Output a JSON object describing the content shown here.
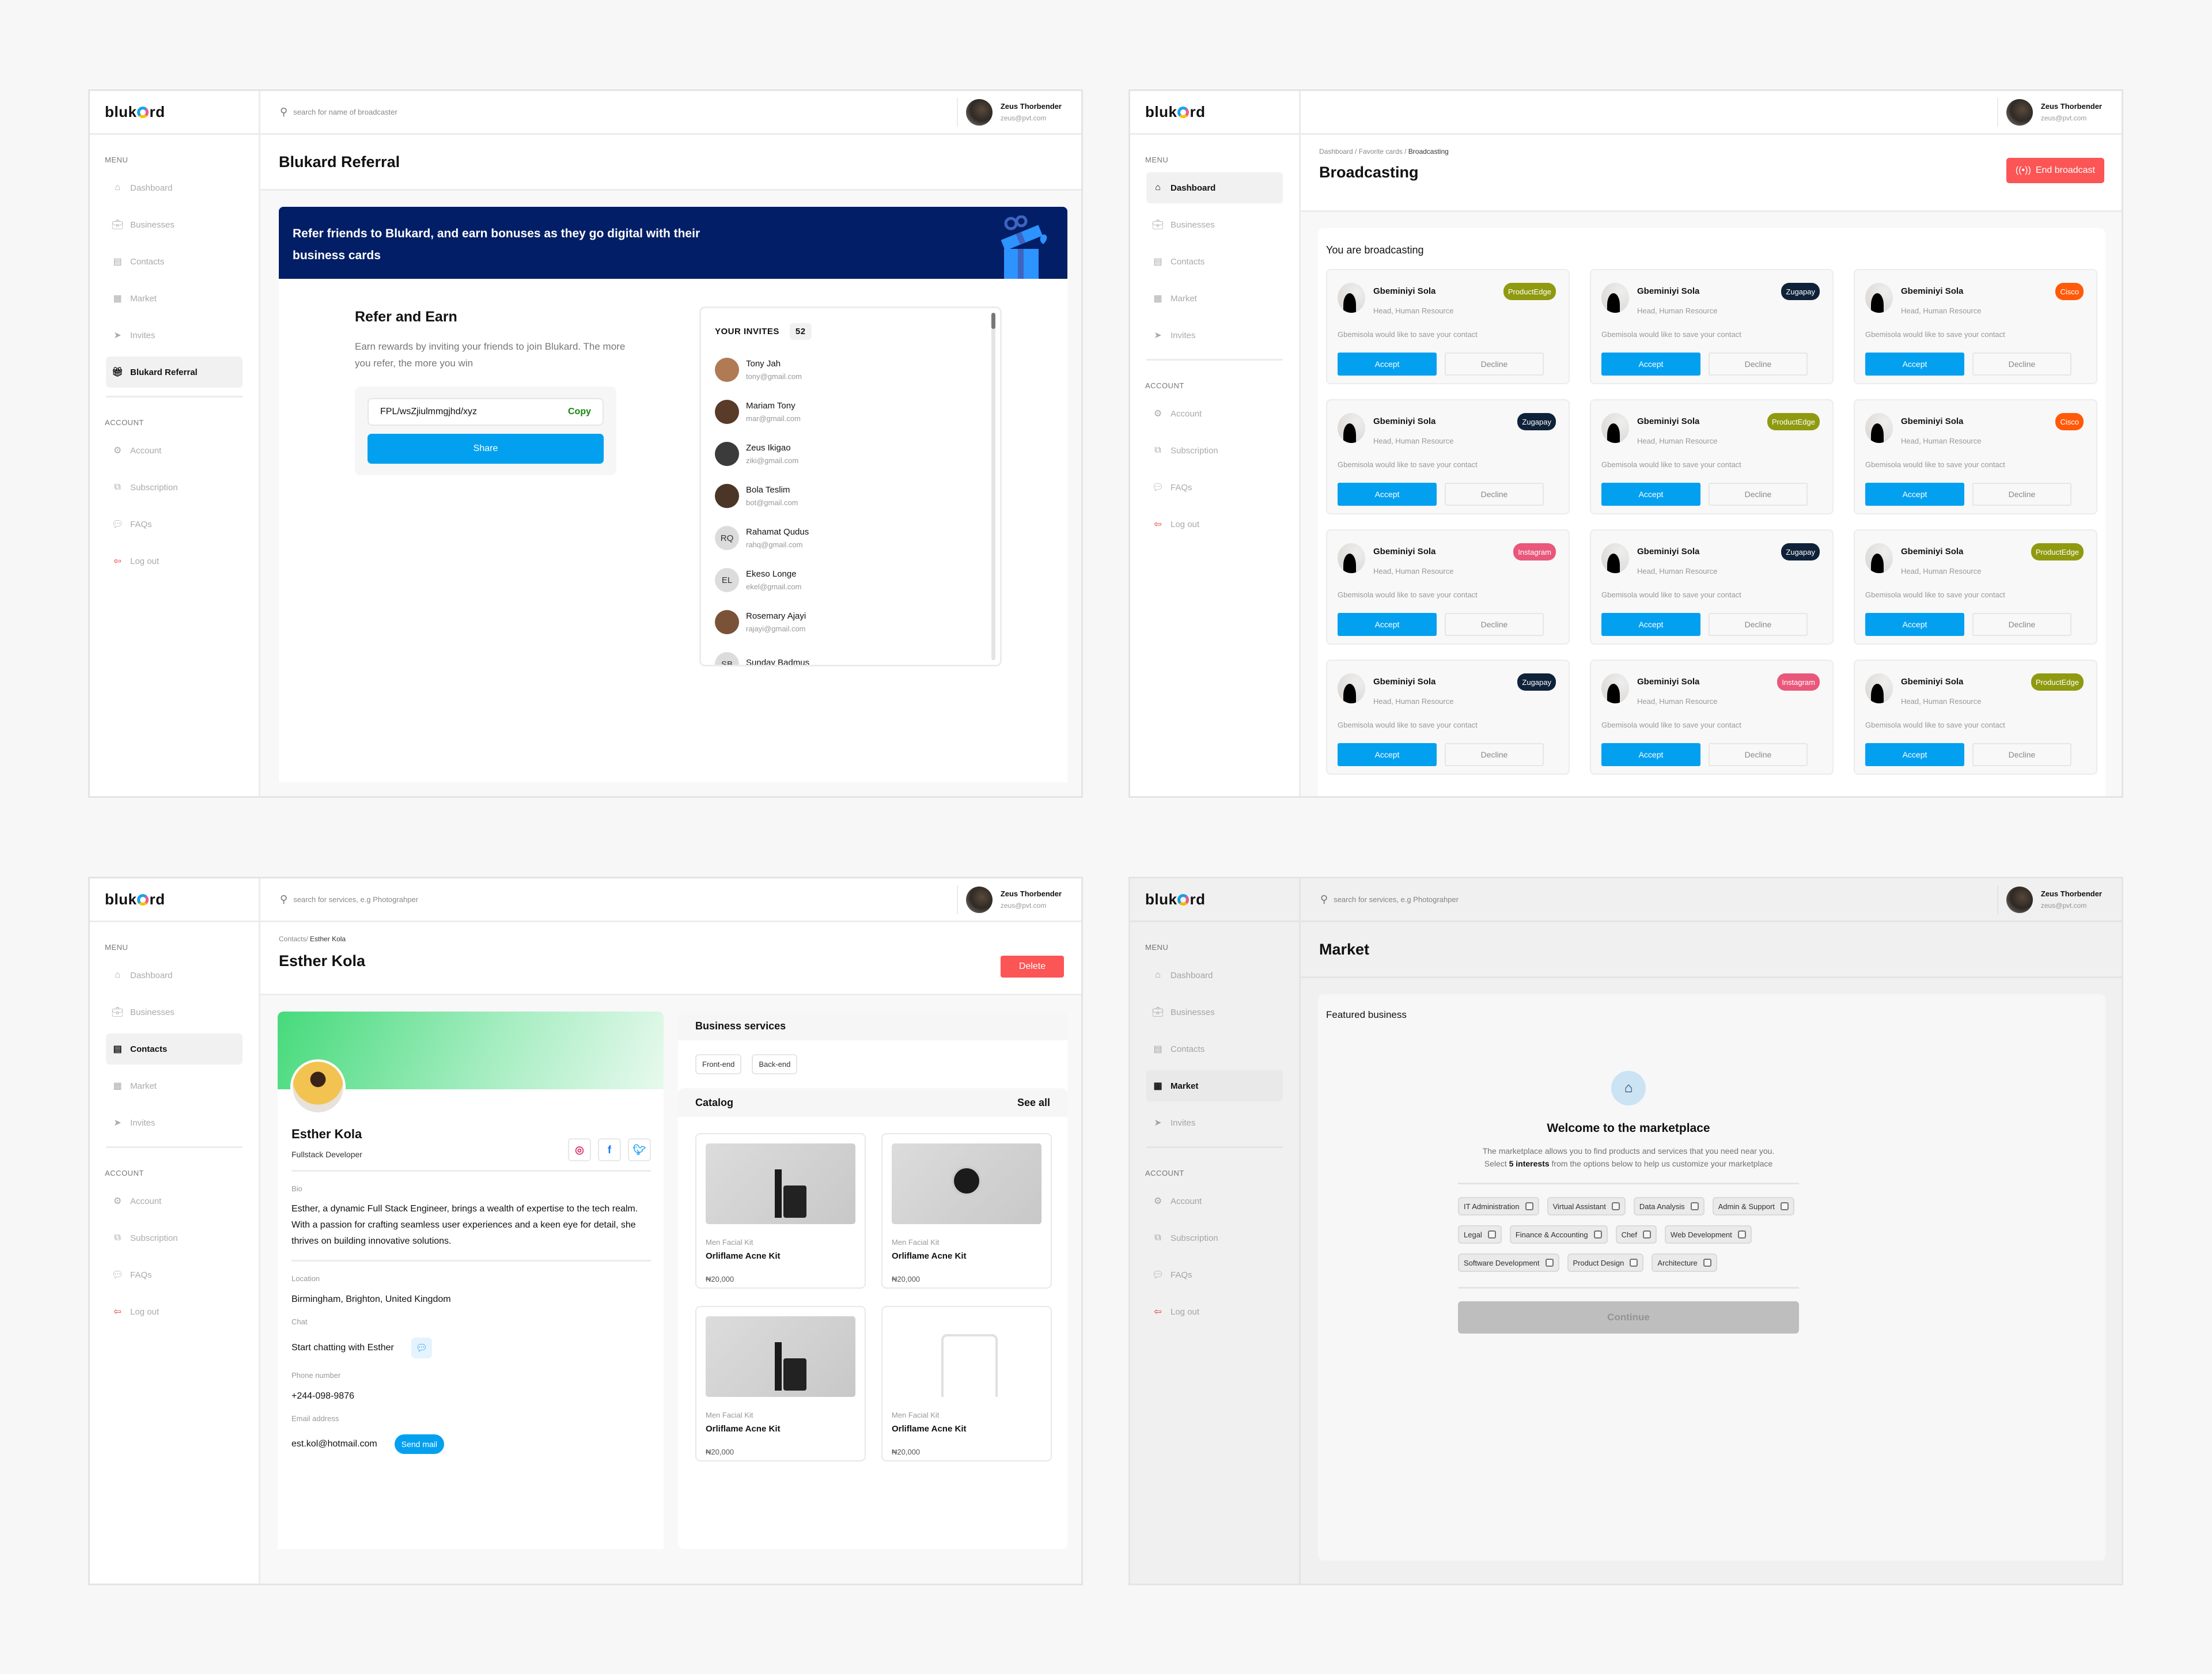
{
  "brand": {
    "logo_prefix": "bluk",
    "logo_suffix": "rd"
  },
  "user": {
    "name": "Zeus Thorbender",
    "email": "zeus@pvt.com"
  },
  "sidebar": {
    "menu_label": "MENU",
    "account_label": "ACCOUNT",
    "menu_items": [
      {
        "label": "Dashboard",
        "icon": "home-icon"
      },
      {
        "label": "Businesses",
        "icon": "briefcase-icon"
      },
      {
        "label": "Contacts",
        "icon": "contacts-card-icon"
      },
      {
        "label": "Market",
        "icon": "store-icon"
      },
      {
        "label": "Invites",
        "icon": "send-icon"
      }
    ],
    "referral_item": {
      "label": "Blukard Referral",
      "icon": "gift-icon"
    },
    "account_items": [
      {
        "label": "Account",
        "icon": "gear-icon"
      },
      {
        "label": "Subscription",
        "icon": "ticket-icon"
      },
      {
        "label": "FAQs",
        "icon": "chat-bubbles-icon"
      },
      {
        "label": "Log out",
        "icon": "logout-icon"
      }
    ]
  },
  "referral": {
    "search_placeholder": "search for name of broadcaster",
    "title": "Blukard Referral",
    "banner": "Refer friends to Blukard, and earn bonuses as they go digital with their business cards",
    "heading": "Refer and Earn",
    "description": "Earn rewards by inviting your friends to join Blukard. The more you refer, the more you win",
    "link": "FPL/wsZjiulmmgjhd/xyz",
    "copy_label": "Copy",
    "share_label": "Share",
    "invites_label": "YOUR INVITES",
    "invites_count": "52",
    "invites": [
      {
        "name": "Tony Jah",
        "email": "tony@gmail.com",
        "initials": "",
        "color": "#b07a55"
      },
      {
        "name": "Mariam Tony",
        "email": "mar@gmail.com",
        "initials": "",
        "color": "#5a3a28"
      },
      {
        "name": "Zeus Ikigao",
        "email": "ziki@gmail.com",
        "initials": "",
        "color": "#3b3b3b"
      },
      {
        "name": "Bola Teslim",
        "email": "bot@gmail.com",
        "initials": "",
        "color": "#4a3526"
      },
      {
        "name": "Rahamat Qudus",
        "email": "rahq@gmail.com",
        "initials": "RQ",
        "color": "#dcdcdc"
      },
      {
        "name": "Ekeso Longe",
        "email": "ekel@gmail.com",
        "initials": "EL",
        "color": "#dcdcdc"
      },
      {
        "name": "Rosemary Ajayi",
        "email": "rajayi@gmail.com",
        "initials": "",
        "color": "#7a5238"
      },
      {
        "name": "Sunday Badmus",
        "email": "",
        "initials": "SB",
        "color": "#dcdcdc"
      }
    ]
  },
  "broadcasting": {
    "breadcrumb": [
      "Dashboard",
      "Favorite cards",
      "Broadcasting"
    ],
    "title": "Broadcasting",
    "end_label": "End broadcast",
    "section_label": "You are broadcasting",
    "accept_label": "Accept",
    "decline_label": "Decline",
    "cards": [
      {
        "name": "Gbeminiyi Sola",
        "role": "Head, Human Resource",
        "message": "Gbemisola would like to save your contact",
        "badge": "ProductEdge",
        "badge_color": "#8f9a10"
      },
      {
        "name": "Gbeminiyi Sola",
        "role": "Head, Human Resource",
        "message": "Gbemisola would like to save your contact",
        "badge": "Zugapay",
        "badge_color": "#0f2239"
      },
      {
        "name": "Gbeminiyi Sola",
        "role": "Head, Human Resource",
        "message": "Gbemisola would like to save your contact",
        "badge": "Cisco",
        "badge_color": "#ff5a0a"
      },
      {
        "name": "Gbeminiyi Sola",
        "role": "Head, Human Resource",
        "message": "Gbemisola would like to save your contact",
        "badge": "Zugapay",
        "badge_color": "#0f2239"
      },
      {
        "name": "Gbeminiyi Sola",
        "role": "Head, Human Resource",
        "message": "Gbemisola would like to save your contact",
        "badge": "ProductEdge",
        "badge_color": "#8f9a10"
      },
      {
        "name": "Gbeminiyi Sola",
        "role": "Head, Human Resource",
        "message": "Gbemisola would like to save your contact",
        "badge": "Cisco",
        "badge_color": "#ff5a0a"
      },
      {
        "name": "Gbeminiyi Sola",
        "role": "Head, Human Resource",
        "message": "Gbemisola would like to save your contact",
        "badge": "Instagram",
        "badge_color": "#e9577a"
      },
      {
        "name": "Gbeminiyi Sola",
        "role": "Head, Human Resource",
        "message": "Gbemisola would like to save your contact",
        "badge": "Zugapay",
        "badge_color": "#0f2239"
      },
      {
        "name": "Gbeminiyi Sola",
        "role": "Head, Human Resource",
        "message": "Gbemisola would like to save your contact",
        "badge": "ProductEdge",
        "badge_color": "#8f9a10"
      },
      {
        "name": "Gbeminiyi Sola",
        "role": "Head, Human Resource",
        "message": "Gbemisola would like to save your contact",
        "badge": "Zugapay",
        "badge_color": "#0f2239"
      },
      {
        "name": "Gbeminiyi Sola",
        "role": "Head, Human Resource",
        "message": "Gbemisola would like to save your contact",
        "badge": "Instagram",
        "badge_color": "#e9577a"
      },
      {
        "name": "Gbeminiyi Sola",
        "role": "Head, Human Resource",
        "message": "Gbemisola would like to save your contact",
        "badge": "ProductEdge",
        "badge_color": "#8f9a10"
      }
    ]
  },
  "contact": {
    "search_placeholder": "search for services, e.g Photograhper",
    "breadcrumb_parent": "Contacts/",
    "breadcrumb_current": "Esther Kola",
    "title": "Esther Kola",
    "delete_label": "Delete",
    "name": "Esther Kola",
    "role": "Fullstack Developer",
    "bio_label": "Bio",
    "bio": "Esther, a dynamic Full Stack Engineer, brings a wealth of expertise to the tech realm. With a passion for crafting seamless user experiences and a keen eye for detail, she thrives on building innovative solutions.",
    "location_label": "Location",
    "location": "Birmingham, Brighton, United Kingdom",
    "chat_label": "Chat",
    "chat_text": "Start chatting with Esther",
    "phone_label": "Phone number",
    "phone": "+244-098-9876",
    "email_label": "Email address",
    "email": "est.kol@hotmail.com",
    "send_mail_label": "Send mail",
    "services_label": "Business services",
    "services": [
      "Front-end",
      "Back-end"
    ],
    "catalog_label": "Catalog",
    "see_all_label": "See all",
    "products": [
      {
        "category": "Men Facial Kit",
        "name": "Orliflame Acne Kit",
        "price": "₦20,000",
        "image": "kit"
      },
      {
        "category": "Men Facial Kit",
        "name": "Orliflame Acne Kit",
        "price": "₦20,000",
        "image": "watch"
      },
      {
        "category": "Men Facial Kit",
        "name": "Orliflame Acne Kit",
        "price": "₦20,000",
        "image": "kit"
      },
      {
        "category": "Men Facial Kit",
        "name": "Orliflame Acne Kit",
        "price": "₦20,000",
        "image": "empty"
      }
    ]
  },
  "market": {
    "search_placeholder": "search for services, e.g Photograhper",
    "title": "Market",
    "featured_label": "Featured business",
    "welcome_title": "Welcome to the marketplace",
    "welcome_text_1": "The marketplace allows you to find products and services that you need near you. Select ",
    "welcome_text_bold": "5 interests",
    "welcome_text_2": " from the options below to help us customize your marketplace",
    "interests": [
      "IT Administration",
      "Virtual Assistant",
      "Data Analysis",
      "Admin & Support",
      "Legal",
      "Finance & Accounting",
      "Chef",
      "Web Development",
      "Software Development",
      "Product Design",
      "Architecture"
    ],
    "continue_label": "Continue"
  },
  "colors": {
    "accent": "#03a0f0",
    "danger": "#fb5555",
    "banner": "#021e66",
    "copy": "#16850f"
  }
}
